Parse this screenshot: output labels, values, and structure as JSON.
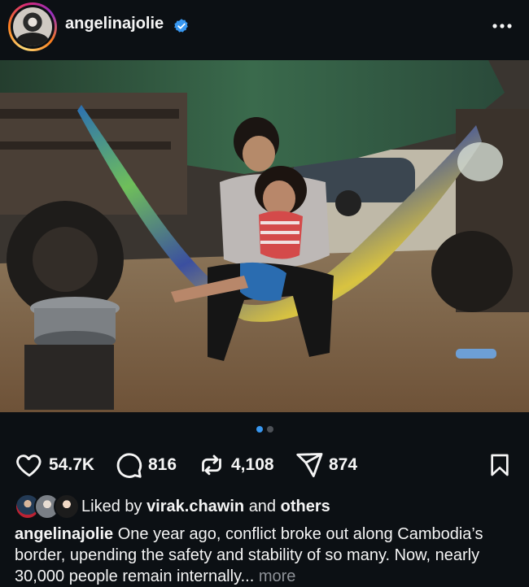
{
  "post": {
    "username": "angelinajolie",
    "verified_icon": "verified-badge-icon",
    "more_icon": "more-options-icon"
  },
  "media": {
    "alt_icon": "post-photo",
    "carousel": {
      "count": 2,
      "active_index": 0
    }
  },
  "actions": {
    "likes": "54.7K",
    "comments": "816",
    "reposts": "4,108",
    "shares": "874"
  },
  "liked_by": {
    "prefix": "Liked by",
    "user": "virak.chawin",
    "conj": "and",
    "others": "others"
  },
  "caption": {
    "user": "angelinajolie",
    "text": "One year ago, conflict broke out along Cambodia’s border, upending the safety and stability of so many. Now, nearly 30,000 people remain internally...",
    "more": "more"
  },
  "colors": {
    "background": "#0c1014",
    "text": "#f5f5f5",
    "verified": "#3897f0",
    "carousel_active": "#3897f0",
    "muted": "#8e9298"
  }
}
